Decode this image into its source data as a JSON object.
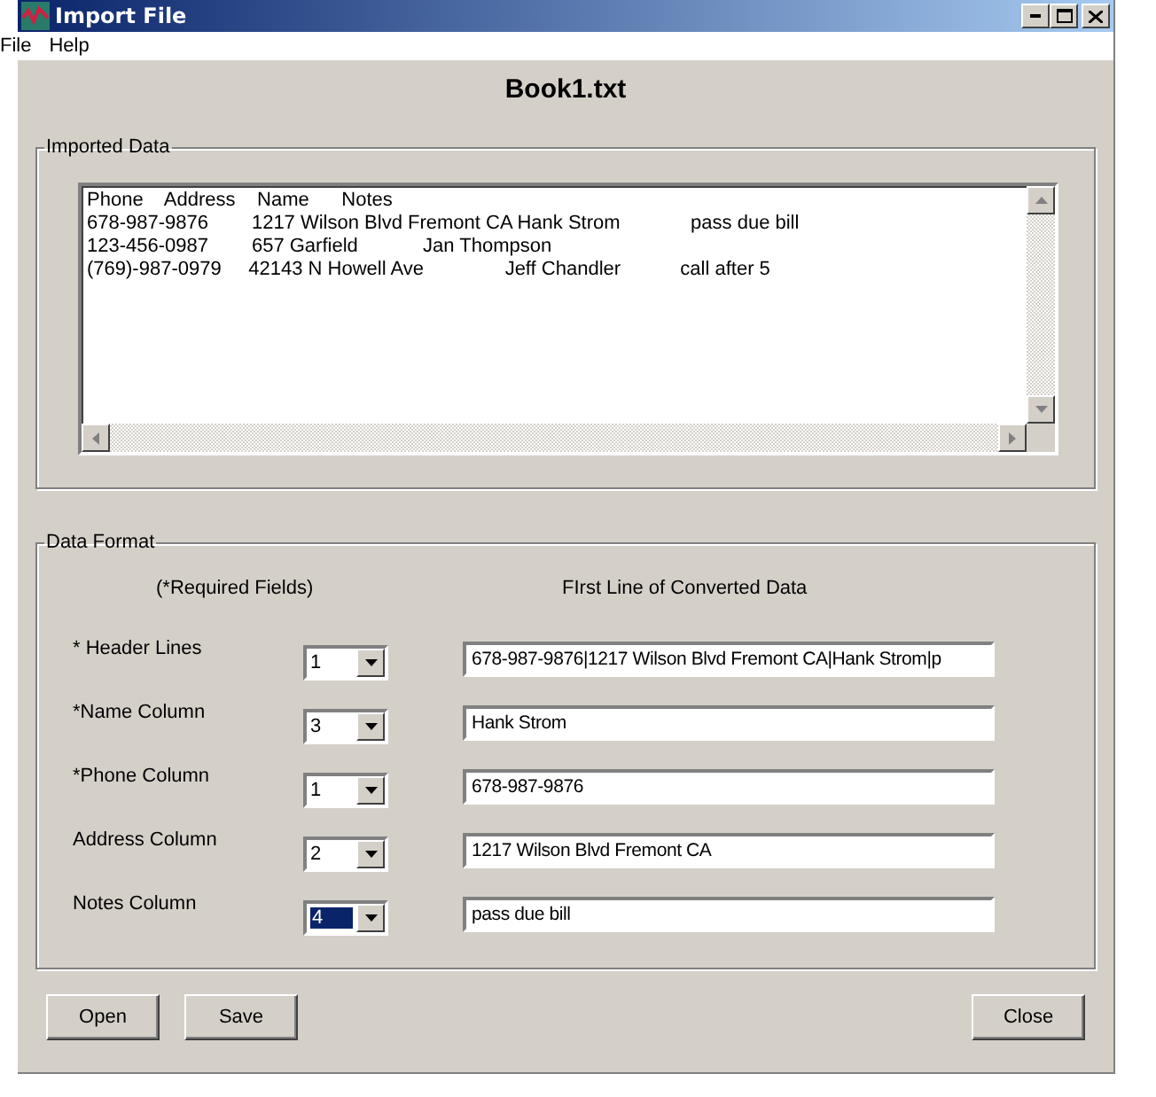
{
  "window": {
    "title": "Import File"
  },
  "menu": [
    "File",
    "Help"
  ],
  "file_name": "Book1.txt",
  "imported_data": {
    "label": "Imported Data",
    "lines": [
      "Phone    Address    Name      Notes",
      "678-987-9876        1217 Wilson Blvd Fremont CA Hank Strom             pass due bill",
      "123-456-0987        657 Garfield            Jan Thompson",
      "(769)-987-0979     42143 N Howell Ave               Jeff Chandler           call after 5"
    ]
  },
  "data_format": {
    "label": "Data Format",
    "required_note": "(*Required Fields)",
    "preview_heading": "FIrst Line of Converted Data",
    "rows": [
      {
        "label": "* Header Lines",
        "value": "1",
        "selected": false,
        "preview": "678-987-9876|1217 Wilson Blvd Fremont CA|Hank Strom|p"
      },
      {
        "label": "*Name Column",
        "value": "3",
        "selected": false,
        "preview": "Hank Strom"
      },
      {
        "label": "*Phone Column",
        "value": "1",
        "selected": false,
        "preview": "678-987-9876"
      },
      {
        "label": "Address Column",
        "value": "2",
        "selected": false,
        "preview": "1217 Wilson Blvd Fremont CA"
      },
      {
        "label": "Notes Column",
        "value": "4",
        "selected": true,
        "preview": "pass due bill"
      }
    ]
  },
  "buttons": {
    "left": [
      "Open",
      "Save"
    ],
    "right": [
      "Close"
    ]
  }
}
